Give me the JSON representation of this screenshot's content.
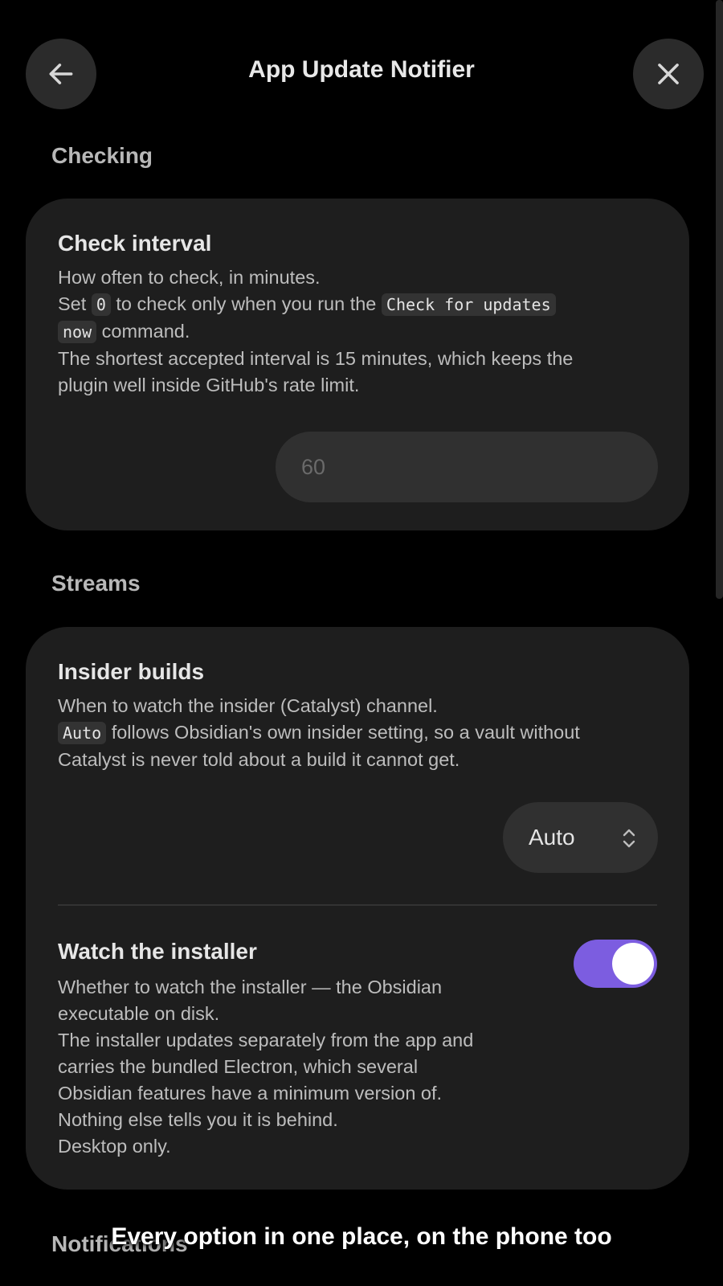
{
  "header": {
    "title": "App Update Notifier",
    "back_icon": "arrow-left-icon",
    "close_icon": "close-icon"
  },
  "sections": {
    "checking": {
      "heading": "Checking",
      "check_interval": {
        "name": "Check interval",
        "desc_line1": "How often to check, in minutes.",
        "desc_line2_a": "Set ",
        "desc_line2_code": "0",
        "desc_line2_b": " to check only when you run the ",
        "desc_line2_code2": "Check for updates",
        "desc_line3_code": "now",
        "desc_line3_b": " command.",
        "desc_line4": "The shortest accepted interval is 15 minutes, which keeps the",
        "desc_line5": "plugin well inside GitHub's rate limit.",
        "input_value": "",
        "input_placeholder": "60"
      }
    },
    "streams": {
      "heading": "Streams",
      "insider_builds": {
        "name": "Insider builds",
        "desc_line1": "When to watch the insider (Catalyst) channel.",
        "desc_line2_code": "Auto",
        "desc_line2_b": " follows Obsidian's own insider setting, so a vault without",
        "desc_line3": "Catalyst is never told about a build it cannot get.",
        "select_value": "Auto"
      },
      "watch_installer": {
        "name": "Watch the installer",
        "desc_lines": [
          "Whether to watch the installer — the Obsidian",
          "executable on disk.",
          "The installer updates separately from the app and",
          "carries the bundled Electron, which several",
          "Obsidian features have a minimum version of.",
          "Nothing else tells you it is behind.",
          "Desktop only."
        ],
        "enabled": true
      }
    },
    "notifications": {
      "heading": "Notifications"
    }
  },
  "caption": "Every option in one place, on the phone too",
  "colors": {
    "background": "#000000",
    "card": "#1e1e1e",
    "accent": "#7c5de0"
  }
}
